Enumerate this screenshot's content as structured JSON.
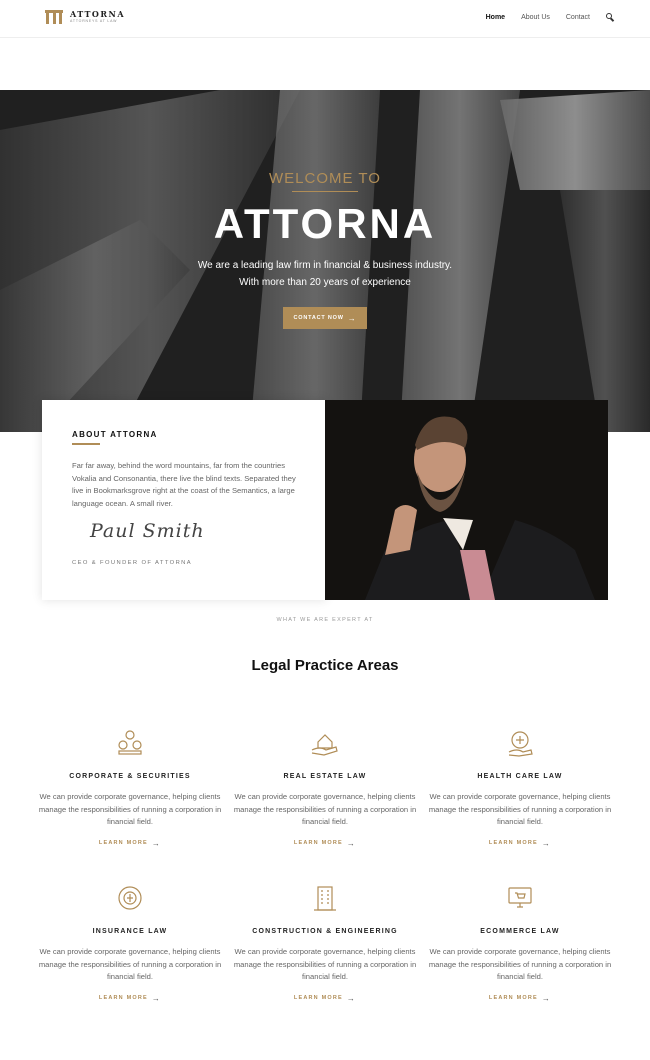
{
  "nav": {
    "brand": "ATTORNA",
    "brand_sub": "ATTORNEYS AT LAW",
    "items": [
      {
        "label": "Home",
        "active": true
      },
      {
        "label": "About Us",
        "active": false
      },
      {
        "label": "Contact",
        "active": false
      }
    ]
  },
  "hero": {
    "welcome": "WELCOME TO",
    "title": "ATTORNA",
    "line1": "We are a leading law firm in financial & business industry.",
    "line2": "With more than 20 years of experience",
    "button": "CONTACT NOW"
  },
  "about": {
    "title": "ABOUT ATTORNA",
    "text": "Far far away, behind the word mountains, far from the countries Vokalia and Consonantia, there live the blind texts. Separated they live in Bookmarksgrove right at the coast of the Semantics, a large language ocean. A small river.",
    "signature": "Paul Smith",
    "role": "CEO & FOUNDER OF ATTORNA"
  },
  "practice": {
    "eyebrow": "WHAT WE ARE EXPERT AT",
    "title": "Legal Practice Areas",
    "areas": [
      {
        "name": "CORPORATE & SECURITIES",
        "icon": "coins-icon",
        "desc": "We can provide corporate governance, helping clients manage the responsibilities of running a corporation in financial field.",
        "more": "LEARN MORE"
      },
      {
        "name": "REAL ESTATE LAW",
        "icon": "house-hand-icon",
        "desc": "We can provide corporate governance, helping clients manage the responsibilities of running a corporation in financial field.",
        "more": "LEARN MORE"
      },
      {
        "name": "HEALTH CARE LAW",
        "icon": "health-icon",
        "desc": "We can provide corporate governance, helping clients manage the responsibilities of running a corporation in financial field.",
        "more": "LEARN MORE"
      },
      {
        "name": "INSURANCE LAW",
        "icon": "insurance-icon",
        "desc": "We can provide corporate governance, helping clients manage the responsibilities of running a corporation in financial field.",
        "more": "LEARN MORE"
      },
      {
        "name": "CONSTRUCTION & ENGINEERING",
        "icon": "building-icon",
        "desc": "We can provide corporate governance, helping clients manage the responsibilities of running a corporation in financial field.",
        "more": "LEARN MORE"
      },
      {
        "name": "ECOMMERCE LAW",
        "icon": "ecommerce-icon",
        "desc": "We can provide corporate governance, helping clients manage the responsibilities of running a corporation in financial field.",
        "more": "LEARN MORE"
      }
    ]
  },
  "colors": {
    "accent": "#b08d57",
    "text": "#222222",
    "muted": "#666666"
  }
}
